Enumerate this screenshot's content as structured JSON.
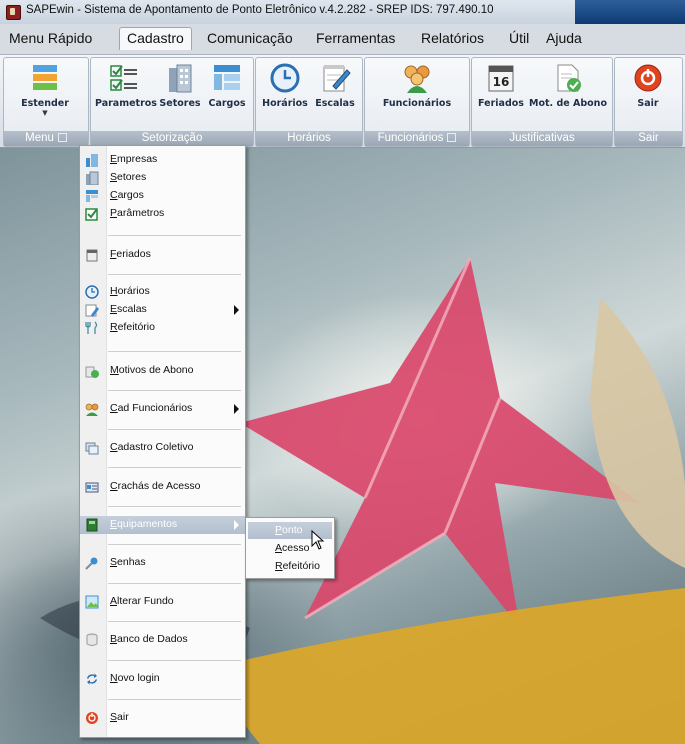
{
  "window": {
    "title": "SAPEwin - Sistema de Apontamento de Ponto Eletrônico  v.4.2.282 - SREP     IDS: 797.490.10"
  },
  "menubar": {
    "items": [
      "Menu Rápido",
      "Cadastro",
      "Comunicação",
      "Ferramentas",
      "Relatórios",
      "Útil",
      "Ajuda"
    ],
    "active": "Cadastro"
  },
  "ribbon": {
    "groups": [
      {
        "label": "Menu",
        "buttons": [
          {
            "label": "Estender",
            "icon": "sidebar-expand-icon"
          }
        ]
      },
      {
        "label": "Setorização",
        "buttons": [
          {
            "label": "Parametros",
            "icon": "checklist-icon"
          },
          {
            "label": "Setores",
            "icon": "building-icon"
          },
          {
            "label": "Cargos",
            "icon": "org-chart-icon"
          }
        ]
      },
      {
        "label": "Horários",
        "buttons": [
          {
            "label": "Horários",
            "icon": "clock-icon"
          },
          {
            "label": "Escalas",
            "icon": "notepad-pencil-icon"
          }
        ]
      },
      {
        "label": "Funcionários",
        "buttons": [
          {
            "label": "Funcionários",
            "icon": "people-icon"
          }
        ]
      },
      {
        "label": "Justificativas",
        "buttons": [
          {
            "label": "Feriados",
            "icon": "calendar-16-icon"
          },
          {
            "label": "Mot. de Abono",
            "icon": "document-check-icon"
          }
        ]
      },
      {
        "label": "Sair",
        "buttons": [
          {
            "label": "Sair",
            "icon": "power-icon"
          }
        ]
      }
    ],
    "calendar_day": "16"
  },
  "dropdown": {
    "items": [
      {
        "label": "Empresas",
        "icon": "buildings-icon"
      },
      {
        "label": "Setores",
        "icon": "building-icon"
      },
      {
        "label": "Cargos",
        "icon": "org-chart-icon"
      },
      {
        "label": "Parâmetros",
        "icon": "checkbox-icon"
      },
      {
        "label": "Feriados",
        "icon": "calendar-icon"
      },
      {
        "label": "Horários",
        "icon": "clock-icon"
      },
      {
        "label": "Escalas",
        "icon": "notepad-icon",
        "submenu": true
      },
      {
        "label": "Refeitório",
        "icon": "cutlery-icon"
      },
      {
        "label": "Motivos de Abono",
        "icon": "document-check-icon"
      },
      {
        "label": "Cad Funcionários",
        "icon": "people-icon",
        "submenu": true
      },
      {
        "label": "Cadastro Coletivo",
        "icon": "group-edit-icon"
      },
      {
        "label": "Crachás de Acesso",
        "icon": "id-card-icon"
      },
      {
        "label": "Equipamentos",
        "icon": "terminal-icon",
        "submenu": true,
        "highlighted": true
      },
      {
        "label": "Senhas",
        "icon": "key-icon"
      },
      {
        "label": "Alterar Fundo",
        "icon": "picture-icon"
      },
      {
        "label": "Banco de Dados",
        "icon": "database-icon"
      },
      {
        "label": "Novo login",
        "icon": "refresh-arrows-icon"
      },
      {
        "label": "Sair",
        "icon": "power-icon"
      }
    ]
  },
  "submenu": {
    "items": [
      {
        "label": "Ponto",
        "highlighted": true
      },
      {
        "label": "Acesso"
      },
      {
        "label": "Refeitório"
      }
    ]
  },
  "colors": {
    "ribbon_group_label": "#9aa6b4",
    "highlight": "#b2bfcf",
    "leaf_red": "#d9466a",
    "leaf_yellow": "#d9a62b"
  }
}
